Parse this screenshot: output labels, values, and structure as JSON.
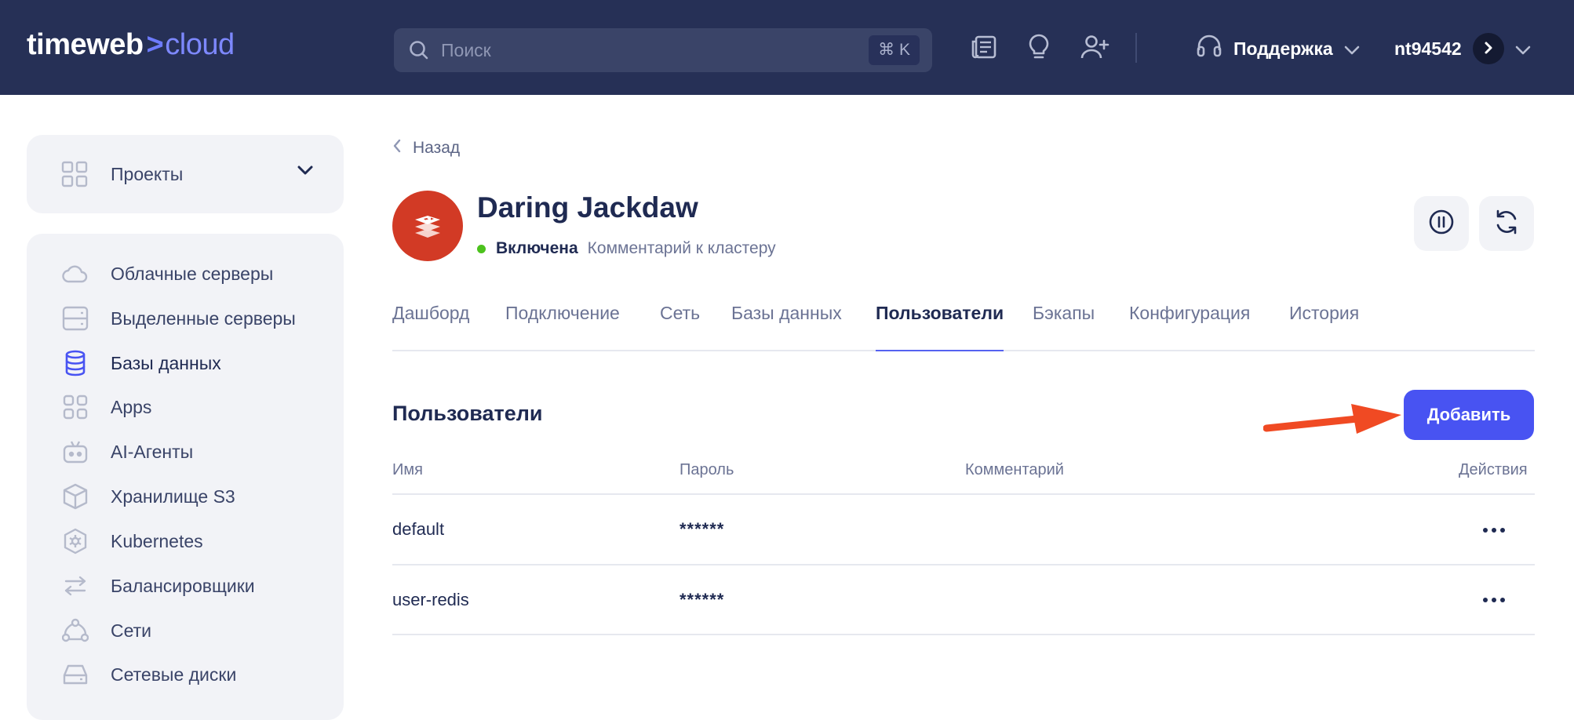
{
  "header": {
    "logo_main": "timeweb",
    "logo_sep": ">",
    "logo_suffix": "cloud",
    "search_placeholder": "Поиск",
    "search_shortcut": "⌘ K",
    "support_label": "Поддержка",
    "username": "nt94542"
  },
  "sidebar": {
    "projects_label": "Проекты",
    "items": [
      {
        "label": "Облачные серверы",
        "icon": "cloud-icon"
      },
      {
        "label": "Выделенные серверы",
        "icon": "server-icon"
      },
      {
        "label": "Базы данных",
        "icon": "database-icon",
        "active": true
      },
      {
        "label": "Apps",
        "icon": "apps-icon"
      },
      {
        "label": "AI-Агенты",
        "icon": "robot-icon"
      },
      {
        "label": "Хранилище S3",
        "icon": "cube-icon"
      },
      {
        "label": "Kubernetes",
        "icon": "kubernetes-icon"
      },
      {
        "label": "Балансировщики",
        "icon": "arrows-icon"
      },
      {
        "label": "Сети",
        "icon": "network-icon"
      },
      {
        "label": "Сетевые диски",
        "icon": "disk-icon"
      }
    ]
  },
  "main": {
    "back_label": "Назад",
    "cluster_name": "Daring Jackdaw",
    "status": "Включена",
    "comment_link": "Комментарий к кластеру",
    "tabs": [
      {
        "label": "Дашборд"
      },
      {
        "label": "Подключение"
      },
      {
        "label": "Сеть"
      },
      {
        "label": "Базы данных"
      },
      {
        "label": "Пользователи",
        "active": true
      },
      {
        "label": "Бэкапы"
      },
      {
        "label": "Конфигурация"
      },
      {
        "label": "История"
      }
    ],
    "section_title": "Пользователи",
    "add_button": "Добавить",
    "table": {
      "headers": {
        "name": "Имя",
        "password": "Пароль",
        "comment": "Комментарий",
        "actions": "Действия"
      },
      "rows": [
        {
          "name": "default",
          "password": "******",
          "comment": ""
        },
        {
          "name": "user-redis",
          "password": "******",
          "comment": ""
        }
      ]
    }
  },
  "colors": {
    "header_bg": "#263056",
    "accent": "#4853f2",
    "db_avatar": "#d23a25",
    "status_ok": "#4cc21d",
    "annotation_arrow": "#f04a23"
  }
}
